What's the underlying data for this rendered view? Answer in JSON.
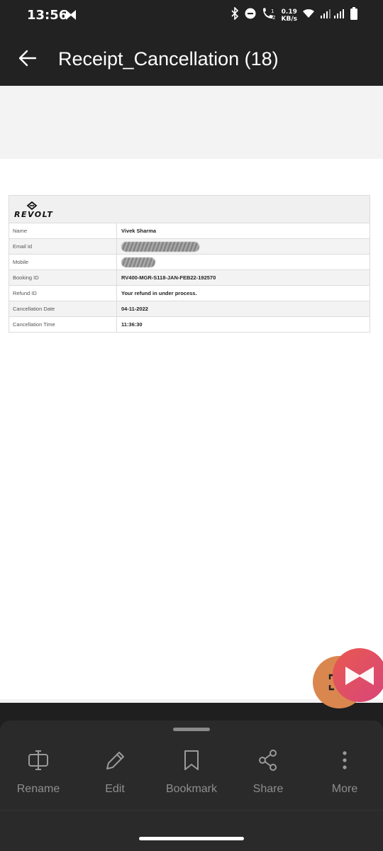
{
  "status_bar": {
    "time": "13:56",
    "net_speed_value": "0.19",
    "net_speed_unit": "KB/s",
    "icons": [
      "app-m-icon",
      "bluetooth-icon",
      "do-not-disturb-icon",
      "call-icon",
      "wifi-icon",
      "signal-icon",
      "battery-icon"
    ]
  },
  "app_bar": {
    "title": "Receipt_Cancellation (18)"
  },
  "receipt": {
    "brand": "REVOLT",
    "rows": [
      {
        "label": "Name",
        "value": "Vivek Sharma"
      },
      {
        "label": "Email Id",
        "value": ""
      },
      {
        "label": "Mobile",
        "value": ""
      },
      {
        "label": "Booking ID",
        "value": "RV400-MGR-S118-JAN-FEB22-192570"
      },
      {
        "label": "Refund ID",
        "value": "Your refund in under process."
      },
      {
        "label": "Cancellation Date",
        "value": "04-11-2022"
      },
      {
        "label": "Cancellation Time",
        "value": "11:36:30"
      }
    ]
  },
  "bottom_sheet": {
    "actions": [
      {
        "label": "Rename",
        "icon": "rename-icon"
      },
      {
        "label": "Edit",
        "icon": "pencil-icon"
      },
      {
        "label": "Bookmark",
        "icon": "bookmark-icon"
      },
      {
        "label": "Share",
        "icon": "share-icon"
      },
      {
        "label": "More",
        "icon": "more-vertical-icon"
      }
    ]
  },
  "colors": {
    "bar_background": "#222222",
    "fab_orange": "#d9874f",
    "fab_pink": "#d8457b"
  }
}
